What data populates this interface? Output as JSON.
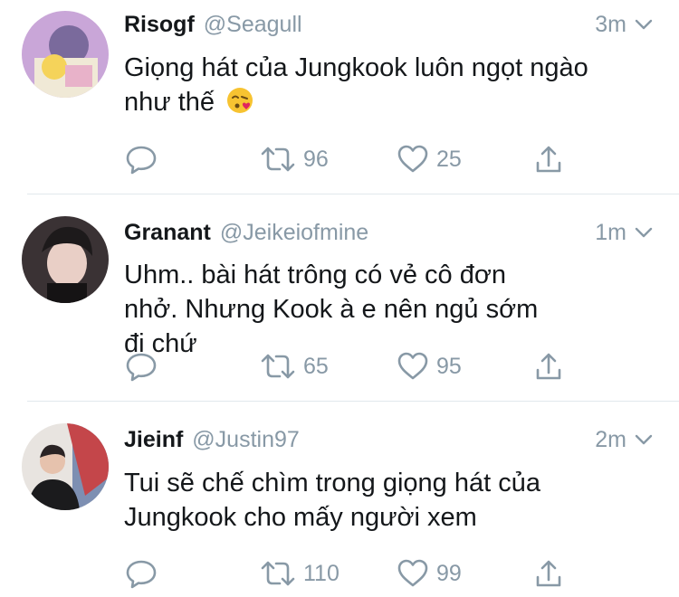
{
  "tweets": [
    {
      "name": "Risogf",
      "handle": "@Seagull",
      "time": "3m",
      "text_lines": [
        "Giọng hát của Jungkook luôn ngọt ngào",
        "như thế"
      ],
      "emoji": "kissing-face-icon",
      "retweets": "96",
      "likes": "25"
    },
    {
      "name": "Granant",
      "handle": "@Jeikeiofmine",
      "time": "1m",
      "text_lines": [
        "Uhm.. bài hát trông có vẻ cô đơn",
        "nhở. Nhưng Kook à e nên ngủ sớm",
        "đi chứ"
      ],
      "retweets": "65",
      "likes": "95"
    },
    {
      "name": "Jieinf",
      "handle": "@Justin97",
      "time": "2m",
      "text_lines": [
        "Tui sẽ chế chìm trong giọng hát của",
        "Jungkook cho mấy người xem"
      ],
      "retweets": "110",
      "likes": "99"
    }
  ],
  "colors": {
    "muted": "#8899a6",
    "text": "#14171a",
    "divider": "#e1e8ed"
  },
  "icons": [
    "reply-icon",
    "retweet-icon",
    "like-icon",
    "share-icon",
    "chevron-down-icon"
  ]
}
